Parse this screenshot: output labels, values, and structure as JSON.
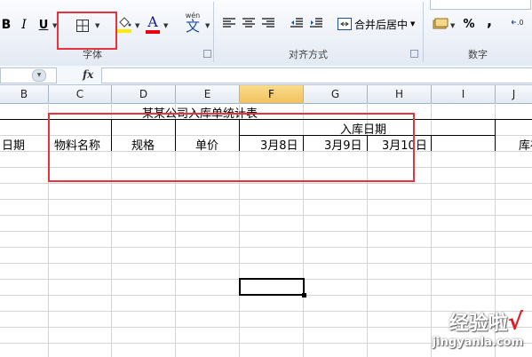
{
  "ribbon": {
    "font_group": {
      "label": "字体",
      "bold": "B",
      "italic": "I",
      "underline": "U",
      "font_color_letter": "A",
      "font_color": "#e8000b",
      "fill_color": "#ffeb00",
      "phonetic_label": "wén",
      "phonetic_char": "文"
    },
    "align_group": {
      "label": "对齐方式",
      "merge_center_label": "合并后居中"
    },
    "number_group": {
      "label": "数字",
      "percent": "%",
      "comma": ","
    }
  },
  "formula_bar": {
    "fx_label": "fx",
    "name_box": "",
    "content": ""
  },
  "columns": [
    "B",
    "C",
    "D",
    "E",
    "F",
    "G",
    "H",
    "I",
    "J"
  ],
  "sheet": {
    "title": "某某公司入库单统计表",
    "headers": {
      "date": "日期",
      "material_name": "物料名称",
      "spec": "规格",
      "unit_price": "单价",
      "inbound_date": "入库日期",
      "stock": "库存"
    },
    "dates": [
      "3月8日",
      "3月9日",
      "3月10日"
    ]
  },
  "watermark": {
    "text": "经验啦",
    "check": "√",
    "url": "jingyanla.com"
  },
  "accent_colors": {
    "highlight_box": "#e8323c",
    "selected_column": "#f5cd72"
  }
}
